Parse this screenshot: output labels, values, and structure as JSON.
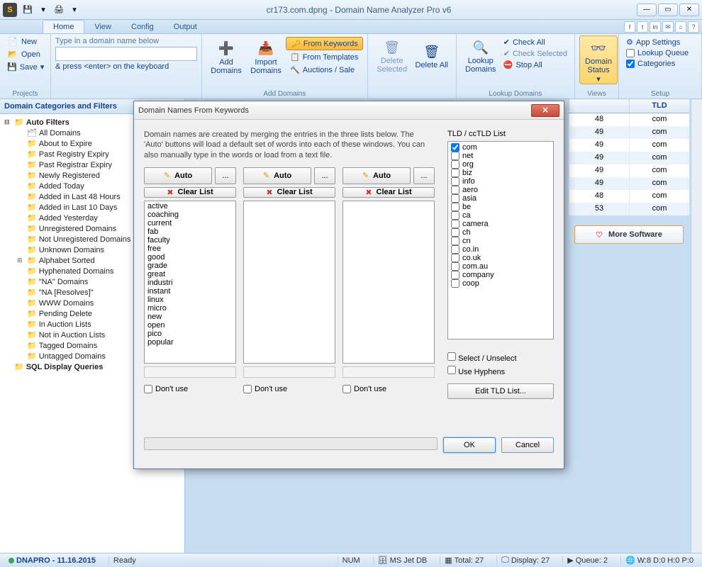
{
  "title": "cr173.com.dpng - Domain Name Analyzer Pro v6",
  "tabs": [
    "Home",
    "View",
    "Config",
    "Output"
  ],
  "projects": {
    "new": "New",
    "open": "Open",
    "save": "Save",
    "label": "Projects"
  },
  "domain_group": {
    "hint1": "Type in a domain name below",
    "hint2": "& press <enter> on the keyboard",
    "value": ""
  },
  "add_domains": {
    "add": "Add Domains",
    "import": "Import Domains",
    "label": "Add Domains",
    "from_keywords": "From Keywords",
    "from_templates": "From Templates",
    "auctions": "Auctions / Sale"
  },
  "delete": {
    "selected": "Delete Selected",
    "all": "Delete All"
  },
  "lookup": {
    "lookup": "Lookup Domains",
    "check_all": "Check All",
    "check_selected": "Check Selected",
    "stop_all": "Stop All",
    "label": "Lookup Domains"
  },
  "views": {
    "domain_status": "Domain Status",
    "label": "Views"
  },
  "setup": {
    "app": "App Settings",
    "queue": "Lookup Queue",
    "categories": "Categories",
    "label": "Setup"
  },
  "sidebar": {
    "header": "Domain Categories and Filters",
    "auto_filters": "Auto Filters",
    "items": [
      "All Domains",
      "About to Expire",
      "Past Registry Expiry",
      "Past Registrar Expiry",
      "Newly Registered",
      "Added Today",
      "Added in Last 48 Hours",
      "Added in Last 10 Days",
      "Added Yesterday",
      "Unregistered Domains",
      "Not Unregistered Domains",
      "Unknown Domains"
    ],
    "alphabet": "Alphabet Sorted",
    "items2": [
      "Hyphenated Domains",
      "\"NA\" Domains",
      "\"NA [Resolves]\"",
      "WWW Domains",
      "Pending Delete",
      "In Auction Lists",
      "Not in Auction Lists",
      "Tagged Domains",
      "Untagged Domains"
    ],
    "sql": "SQL Display Queries"
  },
  "grid": {
    "header_tld": "TLD",
    "rows": [
      {
        "c1": "48",
        "c2": "com"
      },
      {
        "c1": "49",
        "c2": "com"
      },
      {
        "c1": "49",
        "c2": "com"
      },
      {
        "c1": "49",
        "c2": "com"
      },
      {
        "c1": "49",
        "c2": "com"
      },
      {
        "c1": "49",
        "c2": "com"
      },
      {
        "c1": "48",
        "c2": "com"
      },
      {
        "c1": "53",
        "c2": "com"
      }
    ],
    "more": "More Software"
  },
  "dialog": {
    "title": "Domain Names From Keywords",
    "desc": "Domain names are created by merging the entries in the three lists below. The 'Auto' buttons will load a default set of words into each of these windows. You can also manually type in the words or load from a text file.",
    "auto": "Auto",
    "clear": "Clear List",
    "dont_use": "Don't use",
    "ellipsis": "...",
    "words": [
      "active",
      "coaching",
      "current",
      "fab",
      "faculty",
      "free",
      "good",
      "grade",
      "great",
      "industri",
      "instant",
      "linux",
      "micro",
      "new",
      "open",
      "pico",
      "popular"
    ],
    "tld_label": "TLD / ccTLD List",
    "tlds": [
      {
        "n": "com",
        "c": true
      },
      {
        "n": "net",
        "c": false
      },
      {
        "n": "org",
        "c": false
      },
      {
        "n": "biz",
        "c": false
      },
      {
        "n": "info",
        "c": false
      },
      {
        "n": "aero",
        "c": false
      },
      {
        "n": "asia",
        "c": false
      },
      {
        "n": "be",
        "c": false
      },
      {
        "n": "ca",
        "c": false
      },
      {
        "n": "camera",
        "c": false
      },
      {
        "n": "ch",
        "c": false
      },
      {
        "n": "cn",
        "c": false
      },
      {
        "n": "co.in",
        "c": false
      },
      {
        "n": "co.uk",
        "c": false
      },
      {
        "n": "com.au",
        "c": false
      },
      {
        "n": "company",
        "c": false
      },
      {
        "n": "coop",
        "c": false
      }
    ],
    "select_unselect": "Select / Unselect",
    "use_hyphens": "Use Hyphens",
    "edit_tld": "Edit TLD List...",
    "ok": "OK",
    "cancel": "Cancel"
  },
  "status": {
    "app": "DNAPRO - 11.16.2015",
    "ready": "Ready",
    "num": "NUM",
    "db": "MS Jet DB",
    "total": "Total: 27",
    "display": "Display: 27",
    "queue": "Queue: 2",
    "whois": "W:8 D:0 H:0 P:0"
  }
}
